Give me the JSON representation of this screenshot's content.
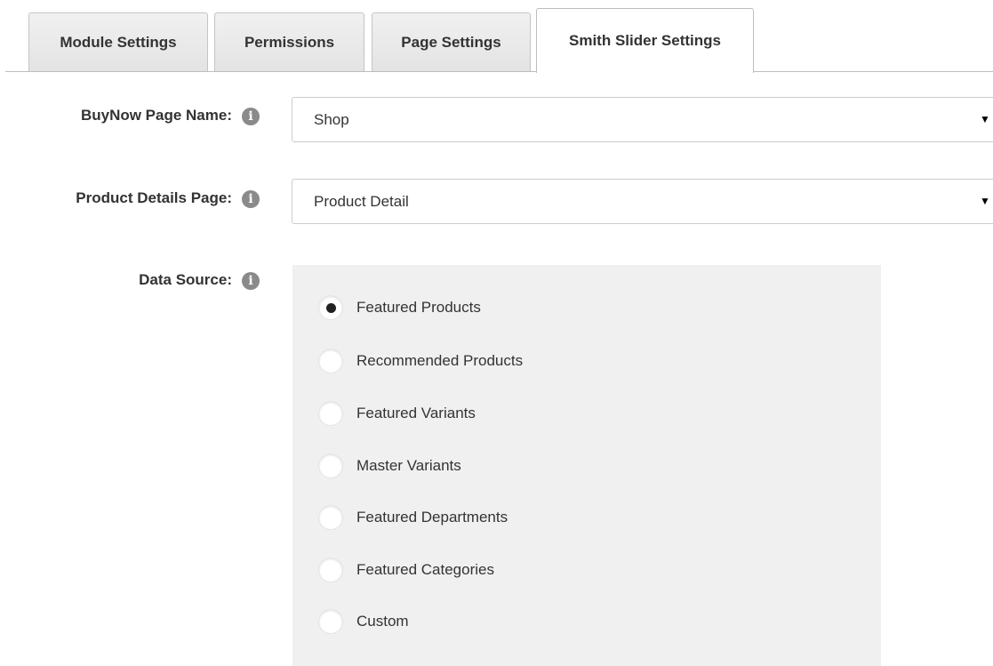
{
  "tabs": [
    {
      "label": "Module Settings",
      "active": false
    },
    {
      "label": "Permissions",
      "active": false
    },
    {
      "label": "Page Settings",
      "active": false
    },
    {
      "label": "Smith Slider Settings",
      "active": true
    }
  ],
  "form": {
    "buynow": {
      "label": "BuyNow Page Name:",
      "value": "Shop"
    },
    "product_details": {
      "label": "Product Details Page:",
      "value": "Product Detail"
    },
    "data_source": {
      "label": "Data Source:",
      "selected": "Featured Products",
      "options": [
        "Featured Products",
        "Recommended Products",
        "Featured Variants",
        "Master Variants",
        "Featured Departments",
        "Featured Categories",
        "Custom"
      ]
    }
  },
  "icons": {
    "info": "info-icon",
    "dropdown": "caret-down-icon"
  },
  "colors": {
    "tab_bg": "#e6e6e6",
    "panel_bg": "#f0f0f0",
    "info_icon": "#8a8a8a"
  }
}
